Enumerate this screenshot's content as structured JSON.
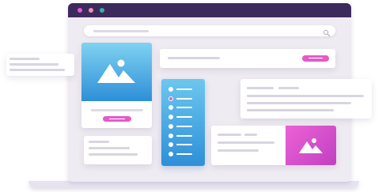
{
  "window": {
    "traffic_lights": [
      {
        "name": "close",
        "color": "#e05bd0"
      },
      {
        "name": "minimize",
        "color": "#f08fb8"
      },
      {
        "name": "maximize",
        "color": "#2fb59c"
      }
    ],
    "titlebar_color": "#3d2a5c",
    "body_color": "#efebf2"
  },
  "search": {
    "placeholder": "",
    "icon": "search-icon"
  },
  "colors": {
    "accent_pink": "#e45ac8",
    "accent_blue": "#3aa6e6",
    "list_gradient_top": "#6cc7ef",
    "list_gradient_bottom": "#2e8fd8"
  },
  "image_card": {
    "icon": "image-icon"
  },
  "pink_card": {
    "icon": "image-icon"
  },
  "list_panel": {
    "items": 8,
    "selected_index": 1
  }
}
